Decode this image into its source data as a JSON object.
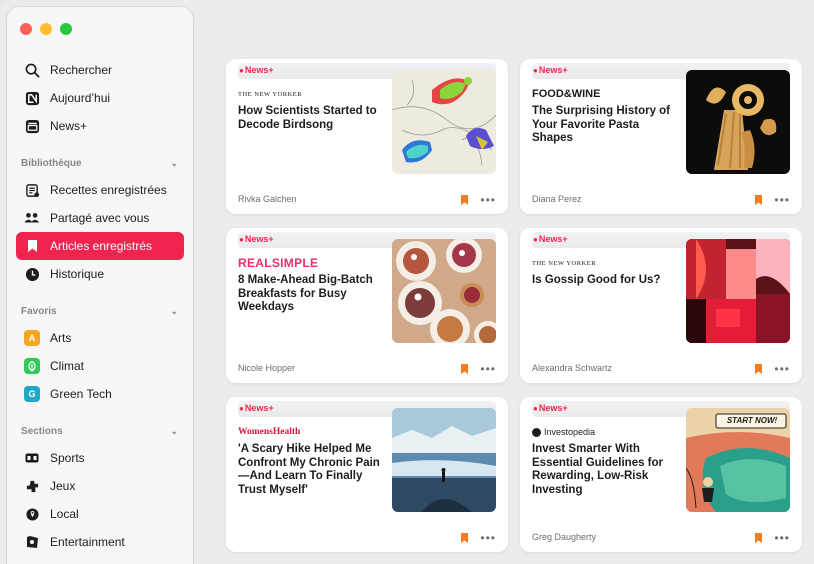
{
  "window": {
    "traffic_lights": {
      "close": "#fe5f57",
      "minimize": "#febc2e",
      "zoom": "#28c840"
    }
  },
  "accent": "#f0254f",
  "sidebar": {
    "top_items": [
      {
        "label": "Rechercher",
        "icon": "search-icon"
      },
      {
        "label": "Aujourd’hui",
        "icon": "news-icon"
      },
      {
        "label": "News+",
        "icon": "news-plus-icon"
      }
    ],
    "library": {
      "title": "Bibliothèque",
      "items": [
        {
          "label": "Recettes enregistrées",
          "icon": "recipes-icon"
        },
        {
          "label": "Partagé avec vous",
          "icon": "shared-icon"
        },
        {
          "label": "Articles enregistrés",
          "icon": "bookmark-icon",
          "selected": true
        },
        {
          "label": "Historique",
          "icon": "clock-icon"
        }
      ]
    },
    "favorites": {
      "title": "Favoris",
      "items": [
        {
          "label": "Arts",
          "badge": "A",
          "color": "#f5a623"
        },
        {
          "label": "Climat",
          "badge": "leaf",
          "color": "#34c759"
        },
        {
          "label": "Green Tech",
          "badge": "G",
          "color": "#1ea9c8"
        }
      ]
    },
    "sections": {
      "title": "Sections",
      "items": [
        {
          "label": "Sports",
          "icon": "scoreboard-icon"
        },
        {
          "label": "Jeux",
          "icon": "puzzle-icon"
        },
        {
          "label": "Local",
          "icon": "location-icon"
        },
        {
          "label": "Entertainment",
          "icon": "ticket-icon"
        }
      ]
    }
  },
  "articles": [
    {
      "tag": "News+",
      "publisher": "THE NEW YORKER",
      "headline": "How Scientists Started to Decode Birdsong",
      "author": "Rivka Galchen"
    },
    {
      "tag": "News+",
      "publisher": "FOOD&WINE",
      "headline": "The Surprising History of Your Favorite Pasta Shapes",
      "author": "Diana Perez"
    },
    {
      "tag": "News+",
      "publisher": "REALSIMPLE",
      "headline": "8 Make-Ahead Big-Batch Breakfasts for Busy Weekdays",
      "author": "Nicole Hopper"
    },
    {
      "tag": "News+",
      "publisher": "THE NEW YORKER",
      "headline": "Is Gossip Good for Us?",
      "author": "Alexandra Schwartz"
    },
    {
      "tag": "News+",
      "publisher": "WomensHealth",
      "headline": "'A Scary Hike Helped Me Confront My Chronic Pain—And Learn To Finally Trust Myself'",
      "author": ""
    },
    {
      "tag": "News+",
      "publisher": "Investopedia",
      "headline": "Invest Smarter With Essential Guidelines for Rewarding, Low-Risk Investing",
      "author": "Greg Daugherty",
      "thumb_text": "START NOW!"
    }
  ]
}
